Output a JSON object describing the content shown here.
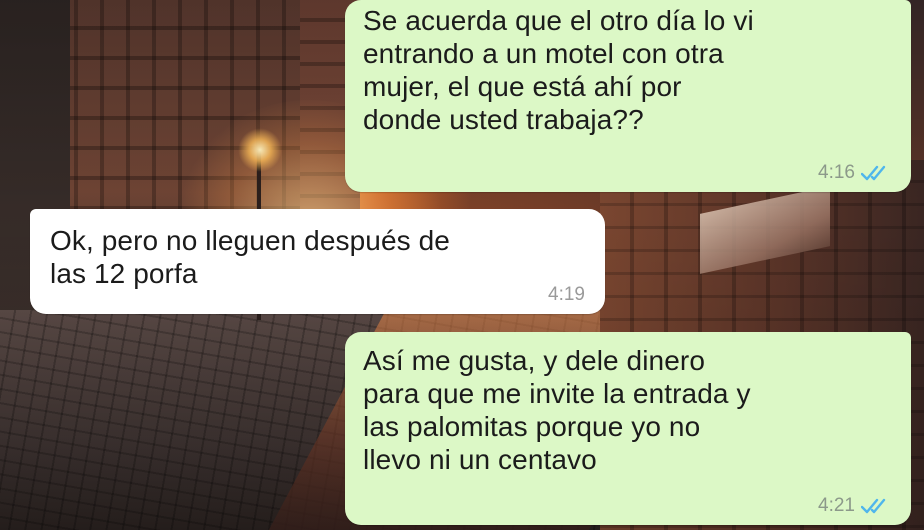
{
  "chat": {
    "messages": [
      {
        "direction": "outgoing",
        "text": "Se acuerda que el otro día lo vi\nentrando a un motel con otra\nmujer, el que está ahí por\ndonde usted trabaja??",
        "time": "4:16",
        "status_icon": "double-check-read-icon"
      },
      {
        "direction": "incoming",
        "text": "Ok, pero no lleguen después de\nlas 12 porfa",
        "time": "4:19"
      },
      {
        "direction": "outgoing",
        "text": "Así me gusta, y dele dinero\npara que me invite la entrada y\nlas palomitas porque yo no\nllevo ni un centavo",
        "time": "4:21",
        "status_icon": "double-check-read-icon"
      }
    ]
  },
  "colors": {
    "outgoing_bubble": "#dcf8c6",
    "incoming_bubble": "#ffffff",
    "read_ticks": "#4fb6ec"
  }
}
